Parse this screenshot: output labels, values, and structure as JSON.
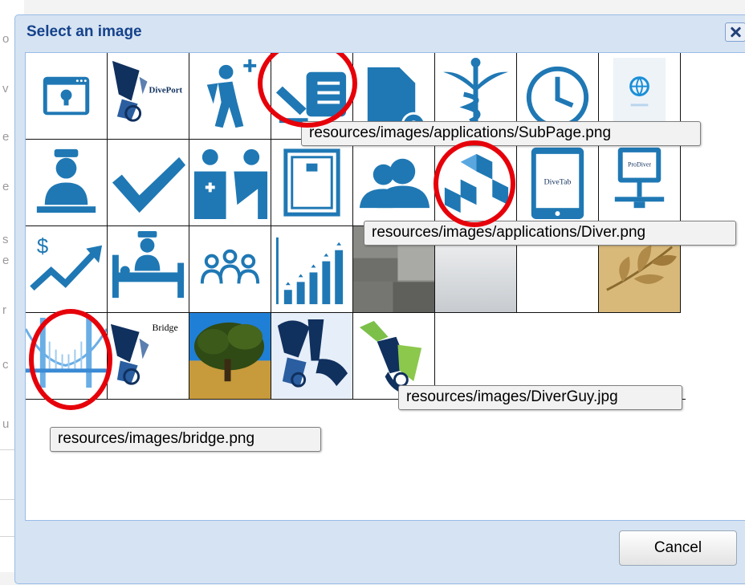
{
  "dialog": {
    "title": "Select an image",
    "close_icon": "close-icon",
    "cancel_label": "Cancel"
  },
  "images": [
    {
      "name": "web-page-lightbulb-image",
      "icon": "browser-lightbulb-icon"
    },
    {
      "name": "diveport-image",
      "icon": "diver-logo-icon",
      "label": "DivePort"
    },
    {
      "name": "hiker-add-image",
      "icon": "hiker-plus-icon"
    },
    {
      "name": "subpage-image",
      "icon": "edit-list-icon"
    },
    {
      "name": "document-settings-image",
      "icon": "document-gear-icon"
    },
    {
      "name": "caduceus-image",
      "icon": "caduceus-icon"
    },
    {
      "name": "clock-image",
      "icon": "clock-icon"
    },
    {
      "name": "globe-app-image",
      "icon": "globe-icon"
    },
    {
      "name": "nurse-image",
      "icon": "nurse-icon"
    },
    {
      "name": "checkmark-image",
      "icon": "checkmark-icon"
    },
    {
      "name": "doctor-patient-image",
      "icon": "doctor-patient-icon"
    },
    {
      "name": "device-panel-image",
      "icon": "panel-icon"
    },
    {
      "name": "users-image",
      "icon": "users-icon"
    },
    {
      "name": "diver-cubes-image",
      "icon": "cubes-icon"
    },
    {
      "name": "divetab-image",
      "icon": "tablet-icon",
      "label": "DiveTab"
    },
    {
      "name": "prodiver-network-image",
      "icon": "network-icon",
      "label": "ProDiver"
    },
    {
      "name": "money-growth-image",
      "icon": "dollar-trend-icon"
    },
    {
      "name": "patient-bed-image",
      "icon": "hospital-bed-icon"
    },
    {
      "name": "team-image",
      "icon": "team-icon"
    },
    {
      "name": "bar-growth-image",
      "icon": "bar-chart-up-icon"
    },
    {
      "name": "gray-squares-image",
      "icon": "gray-blocks-icon"
    },
    {
      "name": "gray-gradient-image",
      "icon": "gray-gradient-icon"
    },
    {
      "name": "blank-image",
      "icon": "blank-icon"
    },
    {
      "name": "leaves-image",
      "icon": "leaves-icon"
    },
    {
      "name": "bridge-image",
      "icon": "bridge-icon"
    },
    {
      "name": "bridge-diver-image",
      "icon": "diver-logo-icon",
      "label": "Bridge"
    },
    {
      "name": "tree-photo-image",
      "icon": "tree-icon"
    },
    {
      "name": "diver-image",
      "icon": "diver-icon"
    },
    {
      "name": "diverguy-image",
      "icon": "diver-guy-icon"
    }
  ],
  "tooltips": {
    "subpage": "resources/images/applications/SubPage.png",
    "diver": "resources/images/applications/Diver.png",
    "diverguy": "resources/images/DiverGuy.jpg",
    "bridge": "resources/images/bridge.png"
  },
  "annotation_color": "#e6000a",
  "accent_blue": "#1e6fa8"
}
